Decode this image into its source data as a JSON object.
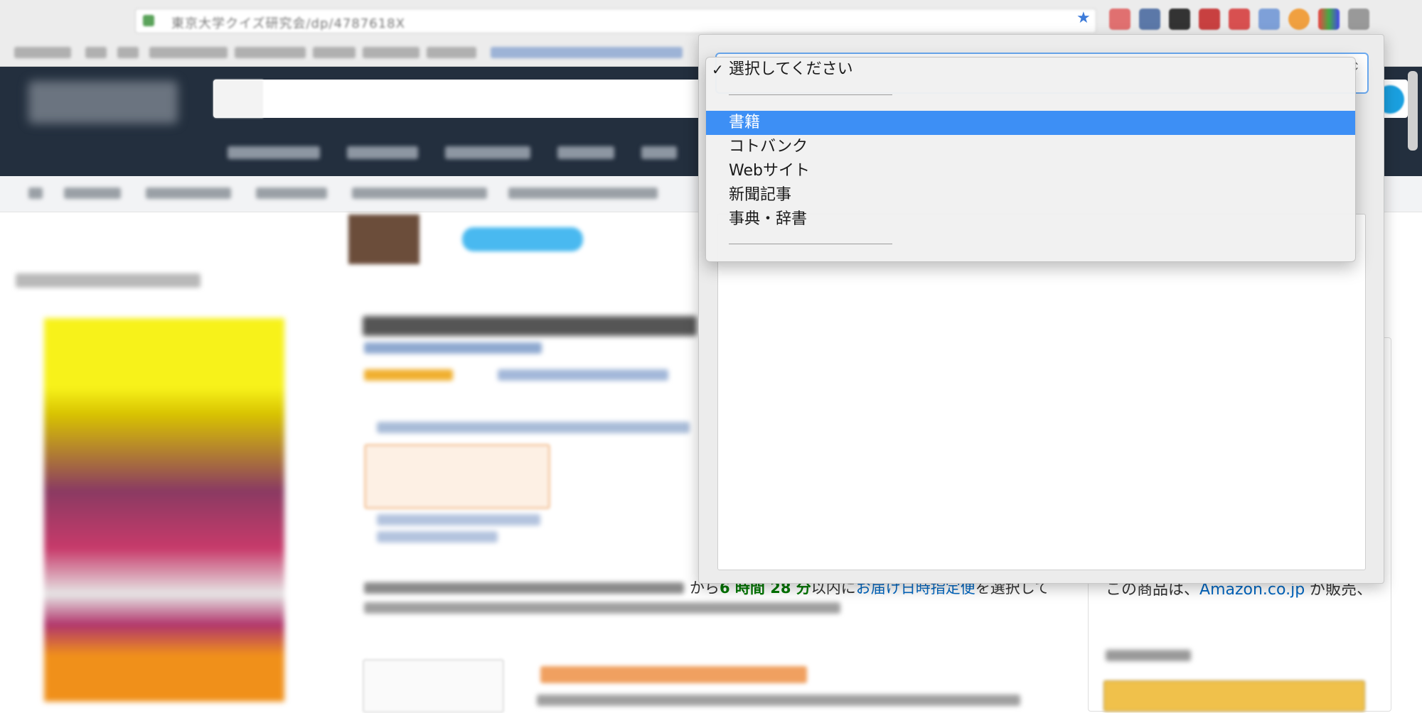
{
  "browser": {
    "url_fragment": "東京大学クイズ研究会/dp/4787618X",
    "bookmark_star": "bookmark-star-icon"
  },
  "page": {
    "delivery_prefix": "から",
    "delivery_time": "6 時間 28 分",
    "delivery_suffix": "以内に",
    "delivery_link": "お届け日時指定便",
    "delivery_tail": "を選択して",
    "seller_prefix": "この商品は、",
    "seller_link": "Amazon.co.jp",
    "seller_suffix": " が販売、"
  },
  "popup": {
    "select_value": "選択してください",
    "dropdown": {
      "checked_label": "選択してください",
      "items": [
        {
          "label": "書籍",
          "highlighted": true
        },
        {
          "label": "コトバンク",
          "highlighted": false
        },
        {
          "label": "Webサイト",
          "highlighted": false
        },
        {
          "label": "新聞記事",
          "highlighted": false
        },
        {
          "label": "事典・辞書",
          "highlighted": false
        }
      ]
    }
  },
  "colors": {
    "header_bg": "#232f3e",
    "dropdown_highlight": "#3d8ff5",
    "link": "#0066c0"
  }
}
